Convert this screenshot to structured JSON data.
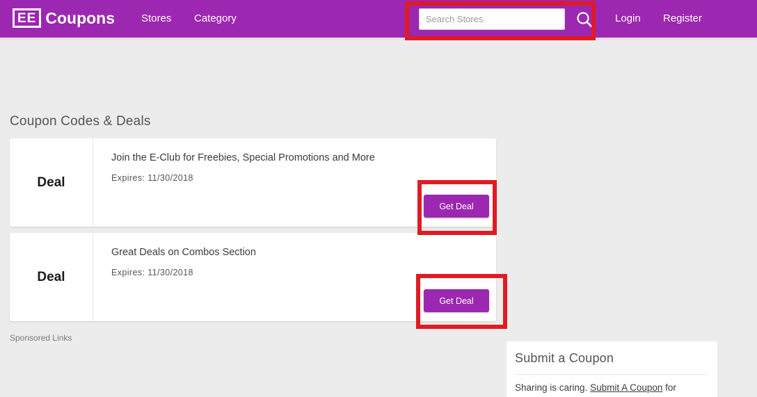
{
  "header": {
    "logo_mark": "EE",
    "logo_text": "Coupons",
    "nav": [
      {
        "label": "Stores"
      },
      {
        "label": "Category"
      },
      {
        "label": "Login"
      },
      {
        "label": "Register"
      }
    ],
    "search": {
      "placeholder": "Search Stores",
      "value": "",
      "icon": "search-icon"
    },
    "background_color": "#9c27b0"
  },
  "main": {
    "section_title": "Coupon Codes & Deals",
    "deals": [
      {
        "badge": "Deal",
        "title": "Join the E-Club for Freebies, Special Promotions and More",
        "expires": "Expires: 11/30/2018",
        "button_label": "Get Deal"
      },
      {
        "badge": "Deal",
        "title": "Great Deals on Combos Section",
        "expires": "Expires: 11/30/2018",
        "button_label": "Get Deal"
      }
    ],
    "sponsored_label": "Sponsored Links"
  },
  "submit_panel": {
    "heading": "Submit a Coupon",
    "text_before": "Sharing is caring. ",
    "link_label": "Submit A Coupon",
    "text_after": " for"
  },
  "highlights": {
    "color": "#e01b24",
    "regions": [
      "search-box",
      "get-deal-button-1",
      "get-deal-button-2"
    ]
  }
}
